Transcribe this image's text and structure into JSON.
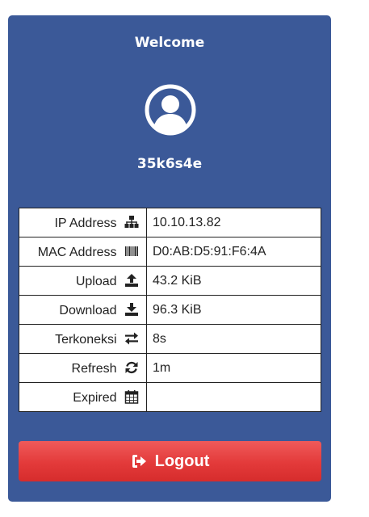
{
  "header": {
    "welcome": "Welcome",
    "username": "35k6s4e",
    "avatar_icon": "user-circle-icon"
  },
  "info": {
    "rows": [
      {
        "label": "IP Address",
        "icon": "sitemap-icon",
        "value": "10.10.13.82"
      },
      {
        "label": "MAC Address",
        "icon": "barcode-icon",
        "value": "D0:AB:D5:91:F6:4A"
      },
      {
        "label": "Upload",
        "icon": "upload-icon",
        "value": "43.2 KiB"
      },
      {
        "label": "Download",
        "icon": "download-icon",
        "value": "96.3 KiB"
      },
      {
        "label": "Terkoneksi",
        "icon": "exchange-icon",
        "value": "8s"
      },
      {
        "label": "Refresh",
        "icon": "refresh-icon",
        "value": "1m"
      },
      {
        "label": "Expired",
        "icon": "calendar-icon",
        "value": ""
      }
    ]
  },
  "actions": {
    "logout_label": "Logout",
    "logout_icon": "sign-out-icon"
  },
  "colors": {
    "card_background": "#3b5998",
    "logout_red": "#e33a3a",
    "text_white": "#ffffff"
  }
}
